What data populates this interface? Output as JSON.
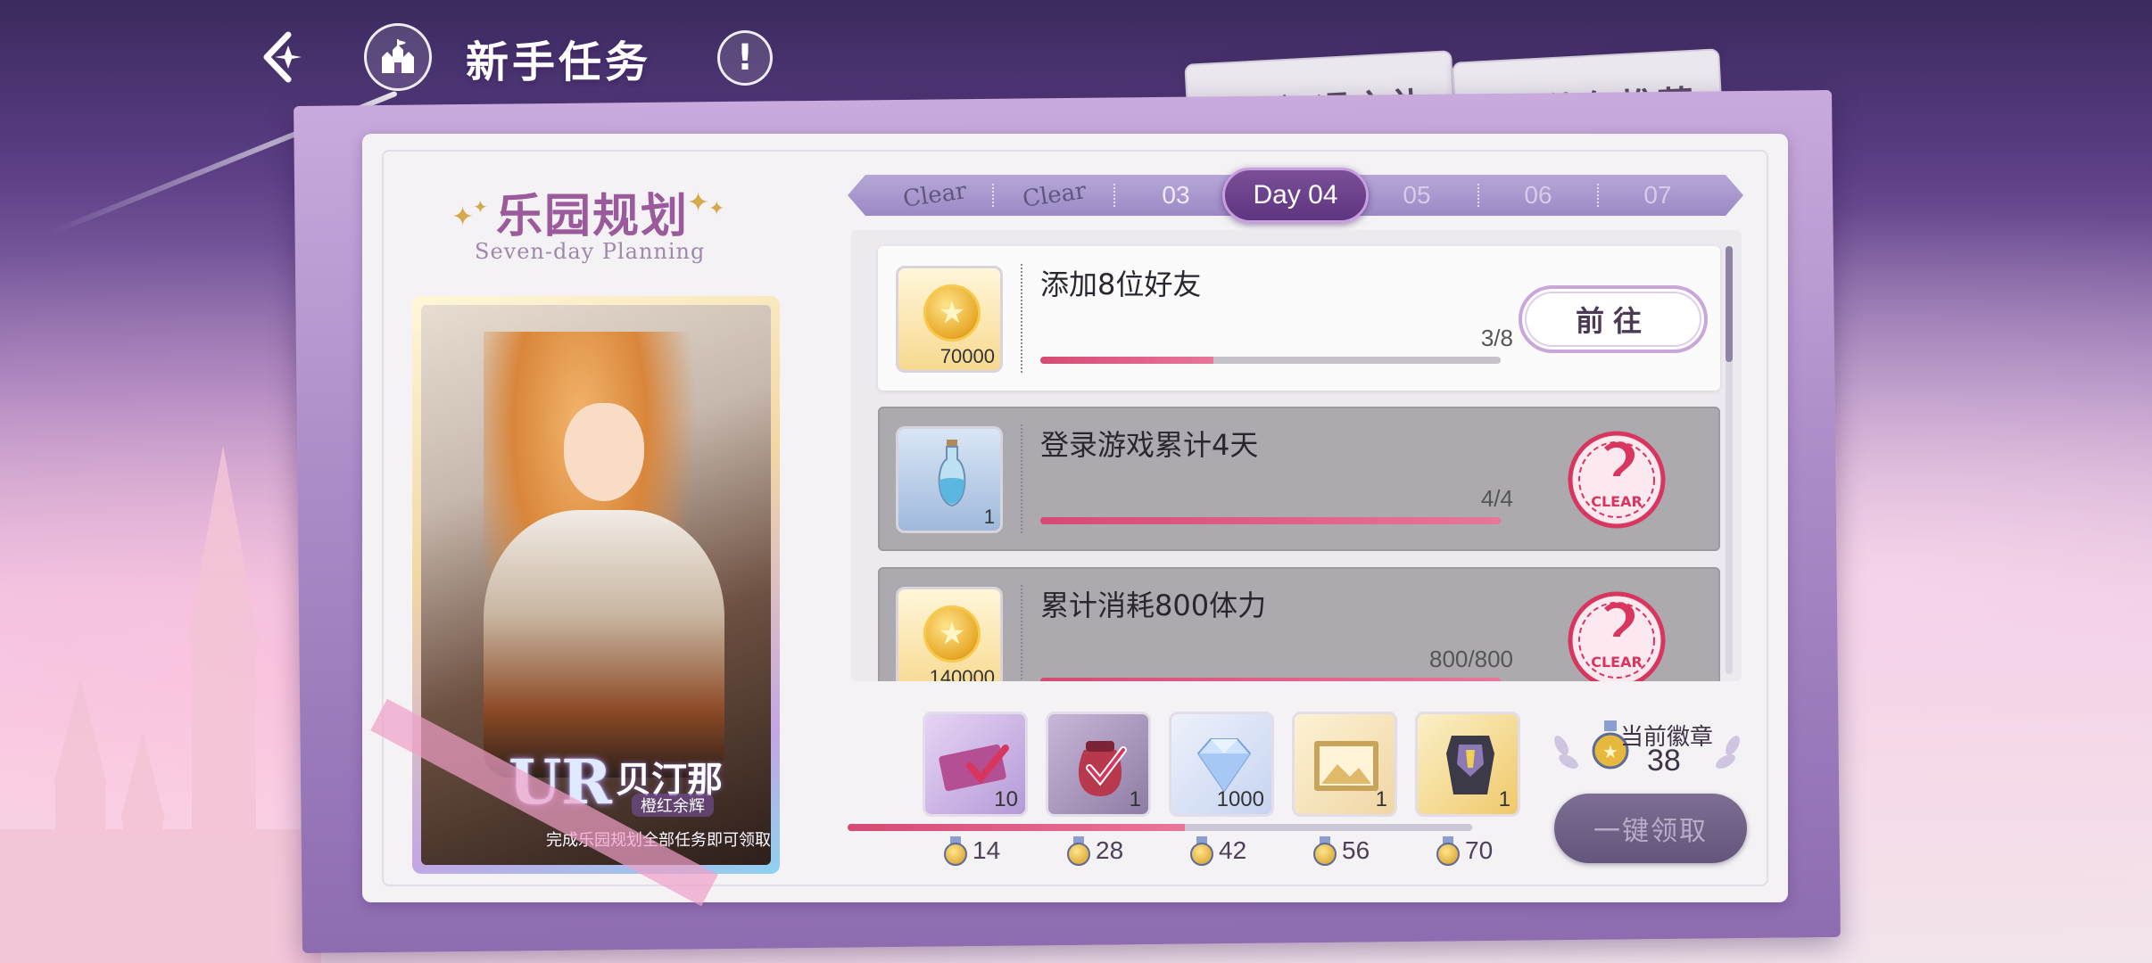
{
  "header": {
    "title": "新手任务"
  },
  "tabs": [
    {
      "label": "初遇之礼"
    },
    {
      "label": "礼包推荐"
    }
  ],
  "plan": {
    "title": "乐园规划",
    "subtitle": "Seven-day Planning"
  },
  "card": {
    "rarity": "UR",
    "name": "贝汀那",
    "subtitle": "橙红余辉",
    "note": "完成乐园规划全部任务即可领取"
  },
  "days": [
    {
      "label": "Clear",
      "state": "cleared"
    },
    {
      "label": "Clear",
      "state": "cleared"
    },
    {
      "label": "03",
      "state": "available"
    },
    {
      "label": "Day 04",
      "state": "active"
    },
    {
      "label": "05",
      "state": "future"
    },
    {
      "label": "06",
      "state": "future"
    },
    {
      "label": "07",
      "state": "future"
    }
  ],
  "tasks": [
    {
      "title": "添加8位好友",
      "reward_count": "70000",
      "reward_icon": "gold-coin-icon",
      "progress_text": "3/8",
      "progress": 0.375,
      "action_label": "前往",
      "state": "active"
    },
    {
      "title": "登录游戏累计4天",
      "reward_count": "1",
      "reward_icon": "potion-bottle-icon",
      "progress_text": "4/4",
      "progress": 1.0,
      "state": "done",
      "stamp_text": "CLEAR"
    },
    {
      "title": "累计消耗800体力",
      "reward_count": "140000",
      "reward_icon": "gold-coin-icon",
      "progress_text": "800/800",
      "progress": 1.0,
      "state": "done",
      "stamp_text": "CLEAR"
    }
  ],
  "milestones": [
    {
      "count": "10",
      "threshold": "14",
      "icon": "ticket-icon"
    },
    {
      "count": "1",
      "threshold": "28",
      "icon": "pouch-icon"
    },
    {
      "count": "1000",
      "threshold": "42",
      "icon": "diamond-icon"
    },
    {
      "count": "1",
      "threshold": "56",
      "icon": "picture-frame-icon"
    },
    {
      "count": "1",
      "threshold": "70",
      "icon": "armor-icon"
    }
  ],
  "milestone_progress": 0.54,
  "badges": {
    "label": "当前徽章",
    "value": "38"
  },
  "claim_all_label": "一键领取",
  "colors": {
    "accent_pink": "#d64a74",
    "day_active": "#6a3f8c",
    "envelope": "#a888c5"
  }
}
